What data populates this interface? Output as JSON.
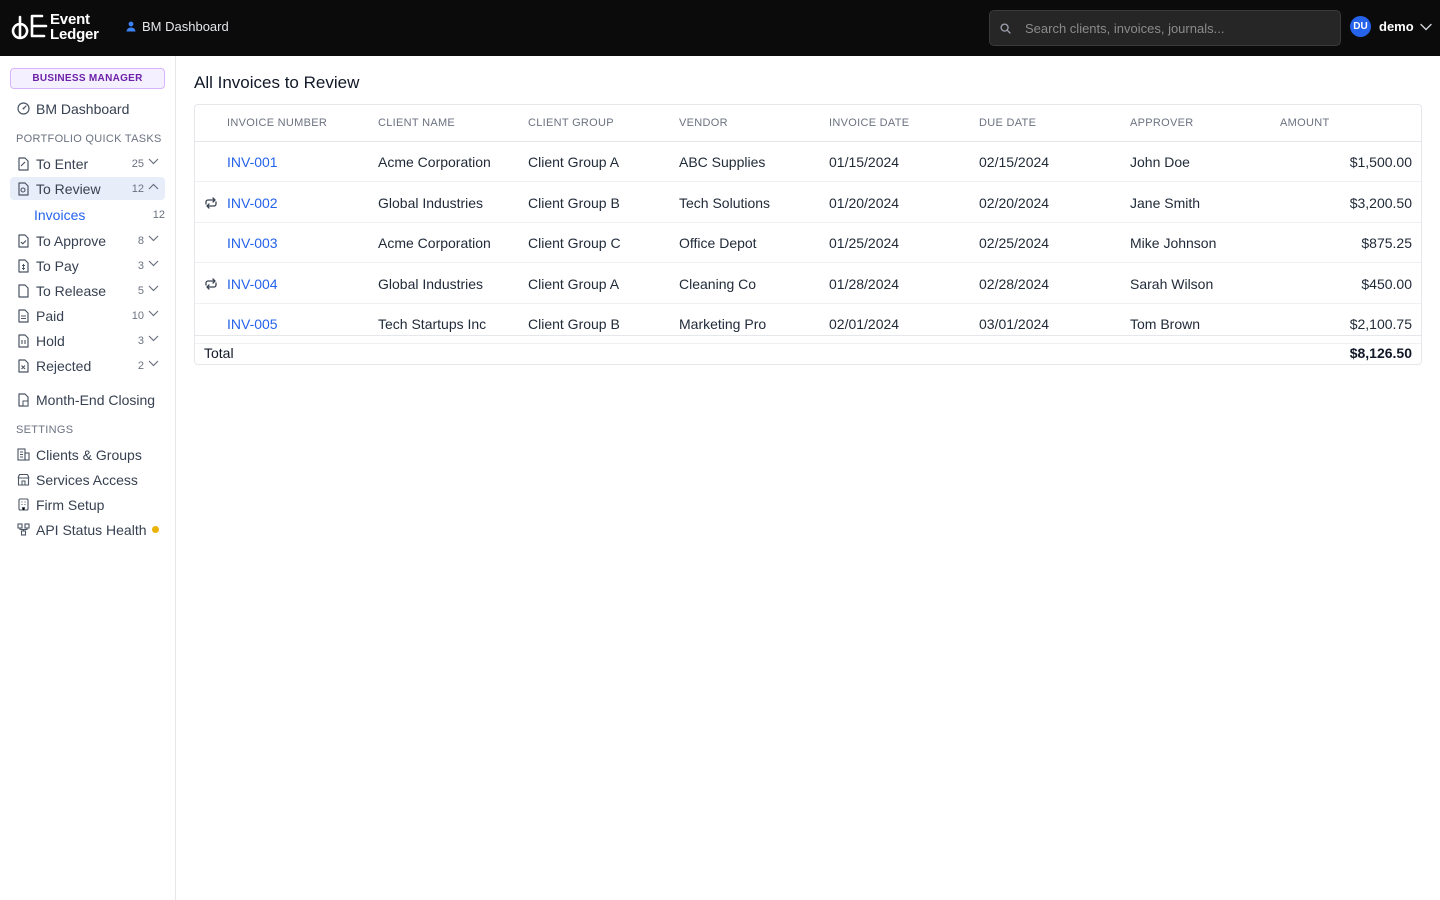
{
  "header": {
    "logo_line1": "Event",
    "logo_line2": "Ledger",
    "breadcrumb": "BM Dashboard",
    "search_placeholder": "Search clients, invoices, journals...",
    "user_initials": "DU",
    "user_name": "demo"
  },
  "sidebar": {
    "role_badge": "BUSINESS MANAGER",
    "dashboard": "BM Dashboard",
    "section_tasks": "PORTFOLIO QUICK TASKS",
    "tasks": [
      {
        "label": "To Enter",
        "count": "25"
      },
      {
        "label": "To Review",
        "count": "12"
      },
      {
        "label": "To Approve",
        "count": "8"
      },
      {
        "label": "To Pay",
        "count": "3"
      },
      {
        "label": "To Release",
        "count": "5"
      },
      {
        "label": "Paid",
        "count": "10"
      },
      {
        "label": "Hold",
        "count": "3"
      },
      {
        "label": "Rejected",
        "count": "2"
      }
    ],
    "sub_item": {
      "label": "Invoices",
      "count": "12"
    },
    "month_end": "Month-End Closing",
    "section_settings": "SETTINGS",
    "settings": [
      {
        "label": "Clients & Groups"
      },
      {
        "label": "Services Access"
      },
      {
        "label": "Firm Setup"
      },
      {
        "label": "API Status Health"
      }
    ],
    "status_color": "#eab308"
  },
  "main": {
    "title": "All Invoices to Review",
    "columns": [
      "INVOICE NUMBER",
      "CLIENT NAME",
      "CLIENT GROUP",
      "VENDOR",
      "INVOICE DATE",
      "DUE DATE",
      "APPROVER",
      "AMOUNT"
    ],
    "rows": [
      {
        "invoice": "INV-001",
        "client": "Acme Corporation",
        "group": "Client Group A",
        "vendor": "ABC Supplies",
        "invoice_date": "01/15/2024",
        "due_date": "02/15/2024",
        "approver": "John Doe",
        "amount": "$1,500.00",
        "recurring": false
      },
      {
        "invoice": "INV-002",
        "client": "Global Industries",
        "group": "Client Group B",
        "vendor": "Tech Solutions",
        "invoice_date": "01/20/2024",
        "due_date": "02/20/2024",
        "approver": "Jane Smith",
        "amount": "$3,200.50",
        "recurring": true
      },
      {
        "invoice": "INV-003",
        "client": "Acme Corporation",
        "group": "Client Group C",
        "vendor": "Office Depot",
        "invoice_date": "01/25/2024",
        "due_date": "02/25/2024",
        "approver": "Mike Johnson",
        "amount": "$875.25",
        "recurring": false
      },
      {
        "invoice": "INV-004",
        "client": "Global Industries",
        "group": "Client Group A",
        "vendor": "Cleaning Co",
        "invoice_date": "01/28/2024",
        "due_date": "02/28/2024",
        "approver": "Sarah Wilson",
        "amount": "$450.00",
        "recurring": true
      },
      {
        "invoice": "INV-005",
        "client": "Tech Startups Inc",
        "group": "Client Group B",
        "vendor": "Marketing Pro",
        "invoice_date": "02/01/2024",
        "due_date": "03/01/2024",
        "approver": "Tom Brown",
        "amount": "$2,100.75",
        "recurring": false
      }
    ],
    "total_label": "Total",
    "total_amount": "$8,126.50"
  },
  "colors": {
    "accent": "#2563eb",
    "topbar": "#0b0b0b",
    "badge": "#6b21a8"
  }
}
